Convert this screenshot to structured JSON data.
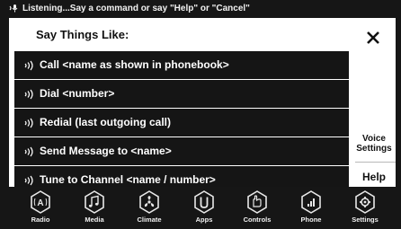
{
  "status": {
    "text": "Listening...Say a command or say \"Help\" or \"Cancel\""
  },
  "panel": {
    "heading": "Say Things Like:",
    "close_icon": "close-icon",
    "commands": [
      {
        "label": "Call <name as shown in phonebook>",
        "icon": "voice-wave-icon"
      },
      {
        "label": "Dial <number>",
        "icon": "voice-wave-icon"
      },
      {
        "label": "Redial (last outgoing call)",
        "icon": "voice-wave-icon"
      },
      {
        "label": "Send Message to <name>",
        "icon": "voice-wave-icon"
      },
      {
        "label": "Tune to Channel <name / number>",
        "icon": "voice-wave-icon"
      }
    ],
    "voice_settings_line1": "Voice",
    "voice_settings_line2": "Settings",
    "help_label": "Help"
  },
  "nav": [
    {
      "label": "Radio",
      "icon": "radio-icon"
    },
    {
      "label": "Media",
      "icon": "music-note-icon"
    },
    {
      "label": "Climate",
      "icon": "fan-icon"
    },
    {
      "label": "Apps",
      "icon": "apps-icon"
    },
    {
      "label": "Controls",
      "icon": "controls-hand-icon"
    },
    {
      "label": "Phone",
      "icon": "phone-icon"
    },
    {
      "label": "Settings",
      "icon": "gear-icon"
    }
  ],
  "colors": {
    "background": "#161616",
    "panel": "#ffffff",
    "command_bar": "#151515",
    "text_light": "#ffffff",
    "text_dark": "#111111"
  }
}
